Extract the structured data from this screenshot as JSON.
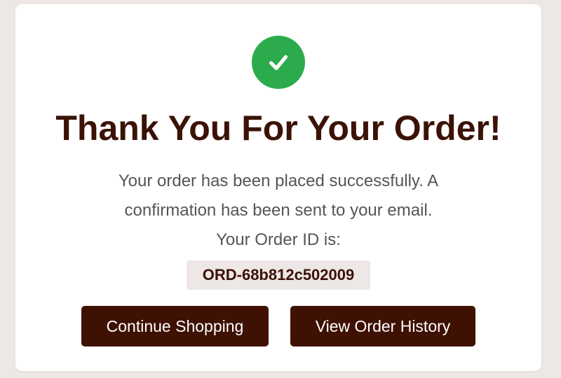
{
  "colors": {
    "success": "#2bab4c",
    "primary": "#3e1103",
    "title": "#3b1206",
    "background": "#ede7e5"
  },
  "icon": "check-circle-icon",
  "title": "Thank You For Your Order!",
  "message": {
    "line1": "Your order has been placed successfully. A",
    "line2": "confirmation has been sent to your email.",
    "line3": "Your Order ID is:"
  },
  "order_id": "ORD-68b812c502009",
  "actions": {
    "continue_label": "Continue Shopping",
    "history_label": "View Order History"
  }
}
